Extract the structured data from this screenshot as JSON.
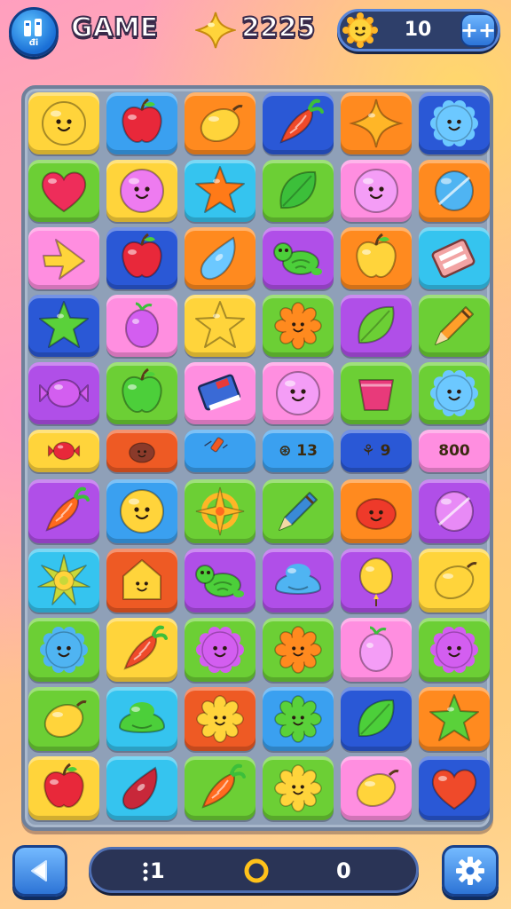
{
  "header": {
    "logo_label": "đ\nđi",
    "title": "GAME",
    "score": "2225",
    "energy": "10",
    "plus_label": "++"
  },
  "footer": {
    "moves": "1",
    "points": "0"
  },
  "colors": {
    "yellow": "#ffd43b",
    "blue": "#3aa0f0",
    "orange": "#ff8a1f",
    "navy": "#2a58d6",
    "green": "#6ccf35",
    "pink": "#ff8ee0",
    "purple": "#b04fe8",
    "red": "#ee5a24",
    "cyan": "#35c4ef"
  },
  "board": {
    "rows": [
      [
        {
          "bg": "yellow",
          "icon": "smiley",
          "fill": "#ffd43b",
          "name": "smiley-face-icon"
        },
        {
          "bg": "blue",
          "icon": "apple",
          "fill": "#e8283a",
          "name": "red-apple-icon"
        },
        {
          "bg": "orange",
          "icon": "lemon",
          "fill": "#ffd43b",
          "name": "lemon-icon"
        },
        {
          "bg": "navy",
          "icon": "carrot",
          "fill": "#ef4a2a",
          "name": "strawberry-icon"
        },
        {
          "bg": "orange",
          "icon": "star4",
          "fill": "#ffb627",
          "name": "sparkle-star-icon"
        },
        {
          "bg": "navy",
          "icon": "spiky",
          "fill": "#6cc8ff",
          "name": "blue-spiky-blob-icon"
        }
      ],
      [
        {
          "bg": "green",
          "icon": "heart",
          "fill": "#ee2d5a",
          "name": "heart-icon"
        },
        {
          "bg": "yellow",
          "icon": "smiley",
          "fill": "#ee7bf0",
          "name": "pink-smiley-icon"
        },
        {
          "bg": "cyan",
          "icon": "star",
          "fill": "#ff7a18",
          "name": "orange-star-icon"
        },
        {
          "bg": "green",
          "icon": "leaf",
          "fill": "#3cbf3a",
          "name": "green-leaf-icon"
        },
        {
          "bg": "pink",
          "icon": "smiley",
          "fill": "#f49df6",
          "name": "pink-smiley-icon"
        },
        {
          "bg": "orange",
          "icon": "orb",
          "fill": "#4fb4f2",
          "name": "blue-candy-icon"
        }
      ],
      [
        {
          "bg": "pink",
          "icon": "arrow",
          "fill": "#ffd43b",
          "name": "yellow-arrow-star-icon"
        },
        {
          "bg": "navy",
          "icon": "apple",
          "fill": "#e8283a",
          "name": "red-apple-icon"
        },
        {
          "bg": "orange",
          "icon": "drop",
          "fill": "#6cc8ff",
          "name": "blue-feather-icon"
        },
        {
          "bg": "purple",
          "icon": "turtle",
          "fill": "#4ccf3a",
          "name": "green-turtle-icon"
        },
        {
          "bg": "orange",
          "icon": "apple",
          "fill": "#ffd43b",
          "name": "yellow-apple-icon"
        },
        {
          "bg": "cyan",
          "icon": "box",
          "fill": "#f2a4a4",
          "name": "card-box-icon"
        }
      ],
      [
        {
          "bg": "navy",
          "icon": "star",
          "fill": "#5ad13a",
          "name": "green-star-icon"
        },
        {
          "bg": "pink",
          "icon": "berry",
          "fill": "#d35ef0",
          "name": "purple-berry-icon"
        },
        {
          "bg": "yellow",
          "icon": "star",
          "fill": "#ffd43b",
          "name": "yellow-star-icon"
        },
        {
          "bg": "green",
          "icon": "flower",
          "fill": "#ff8a1f",
          "name": "orange-flower-icon"
        },
        {
          "bg": "purple",
          "icon": "leaf",
          "fill": "#6ccf35",
          "name": "green-leaves-icon"
        },
        {
          "bg": "green",
          "icon": "pencil",
          "fill": "#ff9f2a",
          "name": "pencil-icon"
        }
      ],
      [
        {
          "bg": "purple",
          "icon": "candy",
          "fill": "#d35ef0",
          "name": "purple-candy-icon"
        },
        {
          "bg": "green",
          "icon": "apple",
          "fill": "#4ccf3a",
          "name": "green-apple-icon"
        },
        {
          "bg": "pink",
          "icon": "book",
          "fill": "#3a6ad6",
          "name": "blue-book-icon"
        },
        {
          "bg": "pink",
          "icon": "smiley",
          "fill": "#f49df6",
          "name": "pink-smiley-icon"
        },
        {
          "bg": "green",
          "icon": "cup",
          "fill": "#e83a7a",
          "name": "pink-cup-icon"
        },
        {
          "bg": "green",
          "icon": "spiky",
          "fill": "#6cc8ff",
          "name": "blue-spiky-blob-icon"
        }
      ]
    ],
    "slim_row": [
      {
        "bg": "yellow",
        "icon": "candy",
        "fill": "#e8283a",
        "name": "red-candy-icon",
        "label": ""
      },
      {
        "bg": "red",
        "icon": "blob",
        "fill": "#8a3a2a",
        "name": "brown-blob-icon",
        "label": ""
      },
      {
        "bg": "blue",
        "icon": "tube",
        "fill": "#ee5a24",
        "name": "tube-icon",
        "label": ""
      },
      {
        "bg": "blue",
        "icon": "",
        "fill": "",
        "name": "tile-label",
        "label": "⊛ 13"
      },
      {
        "bg": "navy",
        "icon": "",
        "fill": "",
        "name": "tile-label",
        "label": "⚘ 9"
      },
      {
        "bg": "pink",
        "icon": "",
        "fill": "",
        "name": "tile-label",
        "label": "800"
      }
    ],
    "rows2": [
      [
        {
          "bg": "purple",
          "icon": "carrot",
          "fill": "#ff6a1f",
          "name": "carrot-icon"
        },
        {
          "bg": "blue",
          "icon": "smiley",
          "fill": "#ffd43b",
          "name": "yellow-smiley-icon"
        },
        {
          "bg": "green",
          "icon": "compass",
          "fill": "#ffb627",
          "name": "compass-icon"
        },
        {
          "bg": "green",
          "icon": "pencil",
          "fill": "#3a8ad6",
          "name": "pen-icon"
        },
        {
          "bg": "orange",
          "icon": "blob",
          "fill": "#ee3a2a",
          "name": "red-blob-icon"
        },
        {
          "bg": "purple",
          "icon": "orb",
          "fill": "#e88af6",
          "name": "pink-balloon-icon"
        }
      ],
      [
        {
          "bg": "cyan",
          "icon": "sun",
          "fill": "#c7d83a",
          "name": "sun-icon"
        },
        {
          "bg": "red",
          "icon": "house",
          "fill": "#ffd43b",
          "name": "yellow-house-icon"
        },
        {
          "bg": "purple",
          "icon": "turtle",
          "fill": "#4ccf3a",
          "name": "green-turtle-icon"
        },
        {
          "bg": "purple",
          "icon": "jelly",
          "fill": "#4fb4f2",
          "name": "blue-jelly-icon"
        },
        {
          "bg": "purple",
          "icon": "balloon",
          "fill": "#ffd43b",
          "name": "yellow-balloon-icon"
        },
        {
          "bg": "yellow",
          "icon": "lemon",
          "fill": "#ffd43b",
          "name": "lemon-icon"
        }
      ],
      [
        {
          "bg": "green",
          "icon": "spiky",
          "fill": "#4fb4f2",
          "name": "blue-spiky-blob-icon"
        },
        {
          "bg": "yellow",
          "icon": "carrot",
          "fill": "#ef4a2a",
          "name": "strawberry-icon"
        },
        {
          "bg": "green",
          "icon": "spiky",
          "fill": "#d35ef0",
          "name": "purple-spiky-blob-icon"
        },
        {
          "bg": "green",
          "icon": "flower",
          "fill": "#ff8a1f",
          "name": "orange-flower-icon"
        },
        {
          "bg": "pink",
          "icon": "berry",
          "fill": "#f49df6",
          "name": "pink-berry-icon"
        },
        {
          "bg": "green",
          "icon": "spiky",
          "fill": "#d35ef0",
          "name": "purple-spiky-blob-icon"
        }
      ],
      [
        {
          "bg": "green",
          "icon": "lemon",
          "fill": "#ffd43b",
          "name": "lemon-icon"
        },
        {
          "bg": "cyan",
          "icon": "jelly",
          "fill": "#4ccf3a",
          "name": "green-jelly-icon"
        },
        {
          "bg": "red",
          "icon": "flower",
          "fill": "#ffd43b",
          "name": "yellow-flower-icon"
        },
        {
          "bg": "blue",
          "icon": "flower",
          "fill": "#5ad13a",
          "name": "green-flower-icon"
        },
        {
          "bg": "navy",
          "icon": "leaf",
          "fill": "#4ccf3a",
          "name": "green-leaf-icon"
        },
        {
          "bg": "orange",
          "icon": "star",
          "fill": "#5ad13a",
          "name": "green-star-icon"
        }
      ],
      [
        {
          "bg": "yellow",
          "icon": "apple",
          "fill": "#e8283a",
          "name": "red-apple-icon"
        },
        {
          "bg": "cyan",
          "icon": "drop",
          "fill": "#c8283a",
          "name": "red-drop-icon"
        },
        {
          "bg": "green",
          "icon": "carrot",
          "fill": "#ff6a1f",
          "name": "orange-fruit-icon"
        },
        {
          "bg": "green",
          "icon": "flower",
          "fill": "#ffd43b",
          "name": "yellow-flower-icon"
        },
        {
          "bg": "pink",
          "icon": "lemon",
          "fill": "#ffd43b",
          "name": "yellow-drop-icon"
        },
        {
          "bg": "navy",
          "icon": "heart",
          "fill": "#ef4a2a",
          "name": "orange-heart-icon"
        }
      ]
    ]
  }
}
